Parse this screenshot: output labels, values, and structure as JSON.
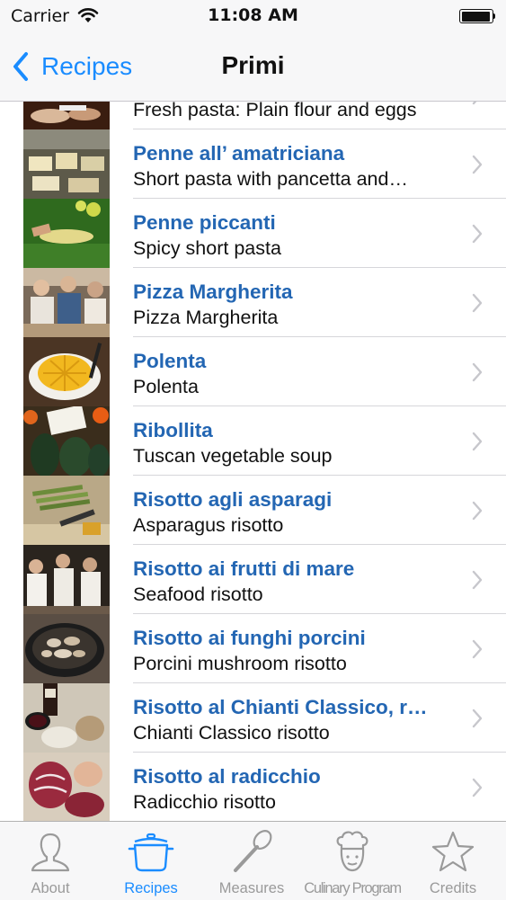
{
  "status_bar": {
    "carrier": "Carrier",
    "time": "11:08 AM"
  },
  "nav": {
    "back_label": "Recipes",
    "title": "Primi"
  },
  "recipes": [
    {
      "title": "",
      "subtitle": "Fresh pasta: Plain flour and eggs"
    },
    {
      "title": "Penne all’ amatriciana",
      "subtitle": "Short pasta with pancetta and…"
    },
    {
      "title": "Penne piccanti",
      "subtitle": "Spicy short pasta"
    },
    {
      "title": "Pizza Margherita",
      "subtitle": "Pizza Margherita"
    },
    {
      "title": "Polenta",
      "subtitle": "Polenta"
    },
    {
      "title": "Ribollita",
      "subtitle": "Tuscan vegetable soup"
    },
    {
      "title": "Risotto agli asparagi",
      "subtitle": "Asparagus risotto"
    },
    {
      "title": "Risotto ai frutti di mare",
      "subtitle": "Seafood risotto"
    },
    {
      "title": "Risotto ai funghi porcini",
      "subtitle": "Porcini mushroom risotto"
    },
    {
      "title": "Risotto al Chianti Classico, r…",
      "subtitle": "Chianti Classico risotto"
    },
    {
      "title": "Risotto al radicchio",
      "subtitle": "Radicchio risotto"
    }
  ],
  "tabs": [
    {
      "label": "About",
      "icon": "person-icon",
      "active": false
    },
    {
      "label": "Recipes",
      "icon": "pot-icon",
      "active": true
    },
    {
      "label": "Measures",
      "icon": "spoon-icon",
      "active": false
    },
    {
      "label": "Culinary Program",
      "icon": "chef-icon",
      "active": false
    },
    {
      "label": "Credits",
      "icon": "star-icon",
      "active": false
    }
  ],
  "colors": {
    "accent": "#1a8cff",
    "title_blue": "#2366b3",
    "inactive_tab": "#9a9a9a"
  }
}
